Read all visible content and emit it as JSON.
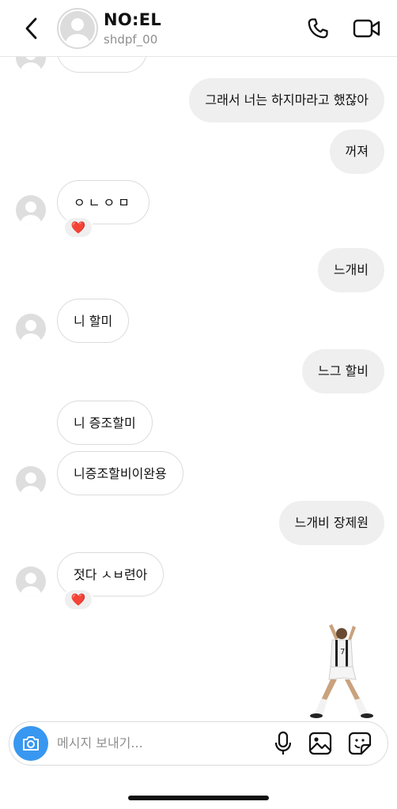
{
  "header": {
    "title": "NO:EL",
    "username": "shdpf_00",
    "icons": {
      "back": "chevron-left-icon",
      "call": "phone-icon",
      "video": "video-camera-icon"
    }
  },
  "messages": [
    {
      "side": "in",
      "text": ""
    },
    {
      "side": "out",
      "text": "그래서 너는 하지마라고 했잖아"
    },
    {
      "side": "out",
      "text": "꺼져"
    },
    {
      "side": "in",
      "text": "ㅇㄴㅇㅁ",
      "reaction": "❤️"
    },
    {
      "side": "out",
      "text": "느개비"
    },
    {
      "side": "in",
      "text": "니 할미"
    },
    {
      "side": "out",
      "text": "느그 할비"
    },
    {
      "side": "in",
      "text": "니 증조할미"
    },
    {
      "side": "in",
      "text": "니증조할비이완용"
    },
    {
      "side": "out",
      "text": "느개비 장제원"
    },
    {
      "side": "in",
      "text": "젓다 ㅅㅂ련아",
      "reaction": "❤️"
    }
  ],
  "composer": {
    "placeholder": "메시지 보내기...",
    "icons": {
      "camera": "camera-icon",
      "mic": "microphone-icon",
      "gallery": "image-icon",
      "sticker": "sticker-icon"
    }
  },
  "colors": {
    "accent": "#3897f0",
    "outgoing_bubble": "#efefef",
    "incoming_border": "#dbdbdb",
    "reaction_heart": "#e0245e"
  }
}
